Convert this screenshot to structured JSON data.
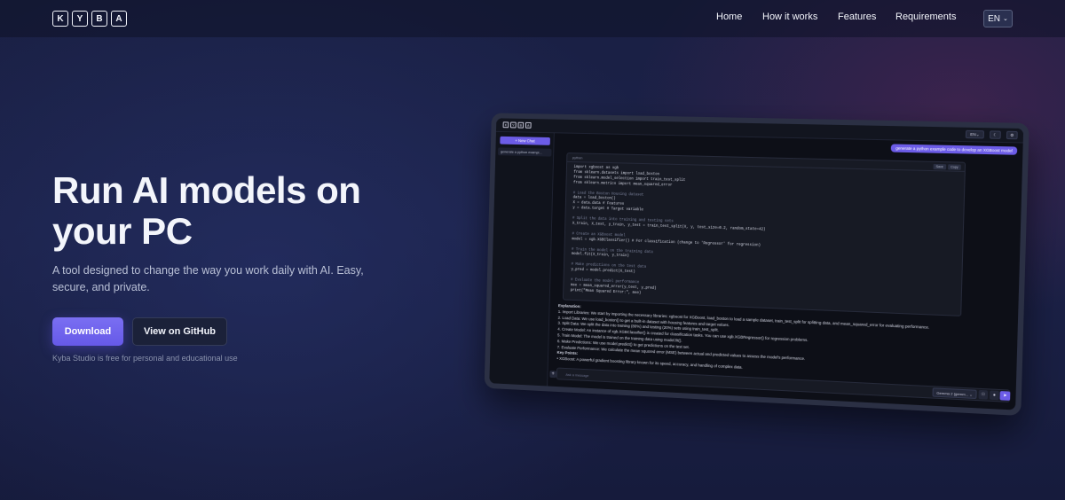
{
  "nav": {
    "logo_letters": [
      "K",
      "Y",
      "B",
      "A"
    ],
    "links": [
      "Home",
      "How it works",
      "Features",
      "Requirements"
    ],
    "language": "EN"
  },
  "hero": {
    "title": "Run AI models on your PC",
    "subtitle": "A tool designed to change the way you work daily with AI. Easy, secure, and private.",
    "download_label": "Download",
    "github_label": "View on GitHub",
    "note": "Kyba Studio is free for personal and educational use"
  },
  "colors": {
    "accent": "#6c5ce7",
    "background": "#1a2044"
  },
  "mockup": {
    "logo_letters": [
      "K",
      "Y",
      "B",
      "A"
    ],
    "lang": "EN",
    "new_chat": "+ New Chat",
    "chat_item": "generate a python exampl...",
    "user_message": "generate a python example code to develop an XGBoost model",
    "code_lang": "python",
    "code_actions": [
      "Save",
      "Copy"
    ],
    "code": [
      "import xgboost as xgb",
      "from sklearn.datasets import load_boston",
      "from sklearn.model_selection import train_test_split",
      "from sklearn.metrics import mean_squared_error",
      "",
      "# Load the Boston Housing dataset",
      "data = load_boston()",
      "X = data.data # Features",
      "y = data.target # Target variable",
      "",
      "# Split the data into training and testing sets",
      "X_train, X_test, y_train, y_test = train_test_split(X, y, test_size=0.2, random_state=42)",
      "",
      "# Create an XGBoost model",
      "model = xgb.XGBClassifier() # For classification (change to 'Regressor' for regression)",
      "",
      "# Train the model on the training data",
      "model.fit(X_train, y_train)",
      "",
      "# Make predictions on the test data",
      "y_pred = model.predict(X_test)",
      "",
      "# Evaluate the model performance",
      "mse = mean_squared_error(y_test, y_pred)",
      "print(\"Mean Squared Error:\", mse)"
    ],
    "explanation_title": "Explanation:",
    "explanation": [
      "1. Import Libraries: We start by importing the necessary libraries: xgboost for XGBoost, load_boston to load a sample dataset, train_test_split for splitting data, and mean_squared_error for evaluating performance.",
      "2. Load Data: We use load_boston() to get a built-in dataset with housing features and target values.",
      "3. Split Data: We split the data into training (80%) and testing (20%) sets using train_test_split.",
      "4. Create Model: An instance of xgb.XGBClassifier() is created for classification tasks. You can use xgb.XGBRegressor() for regression problems.",
      "5. Train Model: The model is trained on the training data using model.fit().",
      "6. Make Predictions: We use model.predict() to get predictions on the test set.",
      "7. Evaluate Performance: We calculate the mean squared error (MSE) between actual and predicted values to assess the model's performance."
    ],
    "key_points_title": "Key Points:",
    "key_points": [
      "XGBoost: A powerful gradient boosting library known for its speed, accuracy, and handling of complex data."
    ],
    "input_placeholder": "Ask a message",
    "model": "Gemma 2 (gemm..."
  }
}
